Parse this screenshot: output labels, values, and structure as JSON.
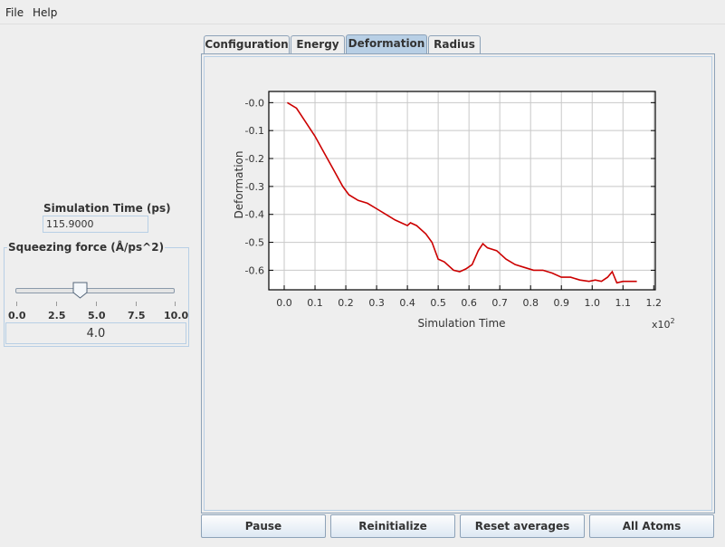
{
  "menu": {
    "file": "File",
    "help": "Help"
  },
  "left": {
    "sim_time_label": "Simulation Time (ps)",
    "sim_time_value": "115.9000",
    "force_title": "Squeezing force (Å/ps^2)",
    "slider": {
      "min": 0,
      "max": 10,
      "value": 4.0,
      "tick_labels": [
        "0.0",
        "2.5",
        "5.0",
        "7.5",
        "10.0"
      ]
    },
    "force_value": "4.0"
  },
  "tabs": [
    {
      "label": "Configuration",
      "active": false
    },
    {
      "label": "Energy",
      "active": false
    },
    {
      "label": "Deformation",
      "active": true
    },
    {
      "label": "Radius",
      "active": false
    }
  ],
  "buttons": {
    "pause": "Pause",
    "reinitialize": "Reinitialize",
    "reset_averages": "Reset averages",
    "all_atoms": "All Atoms"
  },
  "colors": {
    "accent": "#b8cfe5",
    "line": "#cc0000"
  },
  "chart_data": {
    "type": "line",
    "xlabel": "Simulation Time",
    "ylabel": "Deformation",
    "x_multiplier_label": "x10",
    "x_multiplier_exp": "2",
    "xlim": [
      -0.05,
      1.205
    ],
    "ylim": [
      -0.67,
      0.04
    ],
    "x_ticks": [
      0.0,
      0.1,
      0.2,
      0.3,
      0.4,
      0.5,
      0.6,
      0.7,
      0.8,
      0.9,
      1.0,
      1.1,
      1.2
    ],
    "x_tick_labels": [
      "0.0",
      "0.1",
      "0.2",
      "0.3",
      "0.4",
      "0.5",
      "0.6",
      "0.7",
      "0.8",
      "0.9",
      "1.0",
      "1.1",
      "1.2"
    ],
    "y_ticks": [
      0.0,
      -0.1,
      -0.2,
      -0.3,
      -0.4,
      -0.5,
      -0.6
    ],
    "y_tick_labels": [
      "-0.0",
      "-0.1",
      "-0.2",
      "-0.3",
      "-0.4",
      "-0.5",
      "-0.6"
    ],
    "grid": true,
    "series": [
      {
        "color": "#cc0000",
        "x": [
          0.01,
          0.04,
          0.07,
          0.1,
          0.13,
          0.16,
          0.19,
          0.21,
          0.24,
          0.27,
          0.3,
          0.33,
          0.36,
          0.38,
          0.4,
          0.41,
          0.43,
          0.46,
          0.48,
          0.5,
          0.52,
          0.55,
          0.57,
          0.59,
          0.61,
          0.63,
          0.645,
          0.66,
          0.69,
          0.72,
          0.75,
          0.78,
          0.81,
          0.84,
          0.87,
          0.9,
          0.93,
          0.96,
          0.99,
          1.01,
          1.03,
          1.05,
          1.065,
          1.08,
          1.1,
          1.13,
          1.145
        ],
        "y": [
          0.0,
          -0.02,
          -0.07,
          -0.12,
          -0.18,
          -0.24,
          -0.3,
          -0.33,
          -0.35,
          -0.36,
          -0.38,
          -0.4,
          -0.42,
          -0.43,
          -0.44,
          -0.43,
          -0.44,
          -0.47,
          -0.5,
          -0.56,
          -0.57,
          -0.6,
          -0.605,
          -0.595,
          -0.58,
          -0.53,
          -0.505,
          -0.52,
          -0.53,
          -0.56,
          -0.58,
          -0.59,
          -0.6,
          -0.6,
          -0.61,
          -0.625,
          -0.625,
          -0.635,
          -0.64,
          -0.635,
          -0.64,
          -0.625,
          -0.605,
          -0.645,
          -0.64,
          -0.64,
          -0.64
        ]
      }
    ]
  }
}
